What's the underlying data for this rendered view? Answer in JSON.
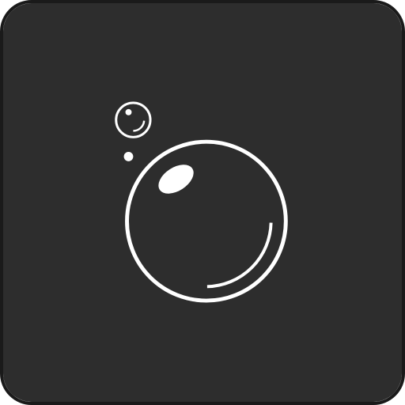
{
  "icon": {
    "name": "bubbles-icon",
    "colors": {
      "background": "#2d2d2d",
      "border": "#1a1a1a",
      "bubble_stroke": "#ffffff",
      "highlight_fill": "#ffffff"
    }
  }
}
